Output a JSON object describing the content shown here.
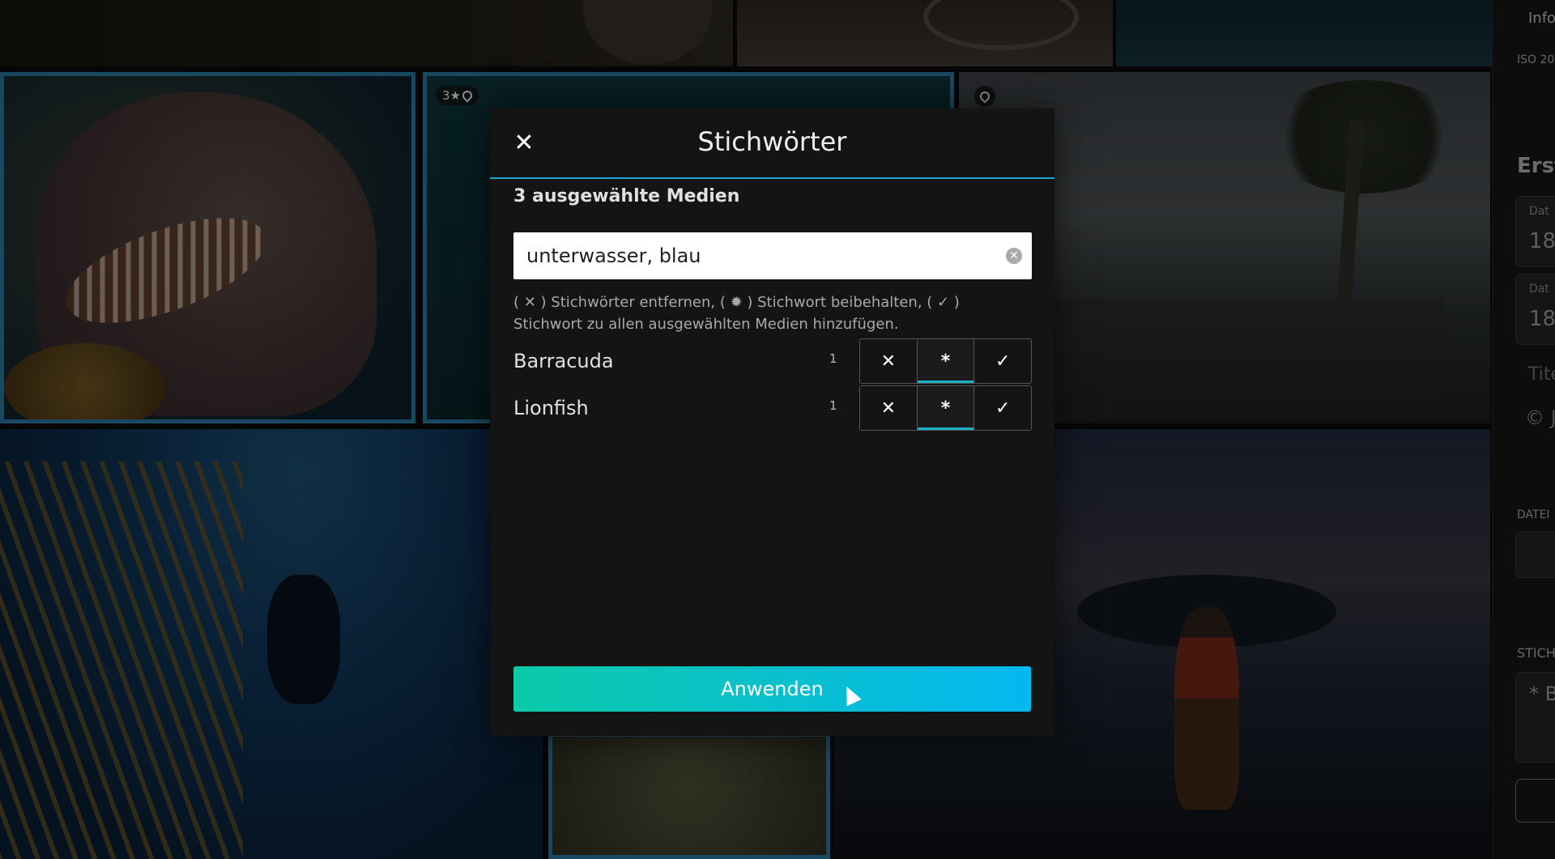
{
  "grid": {
    "badges": {
      "rating": "3★",
      "pin_icon": "map-pin-icon"
    }
  },
  "right_panel": {
    "info_tab": "Info",
    "iso_fragment": "ISO 20",
    "section_title": "Erste",
    "field1": {
      "label": "Dat",
      "value": "18"
    },
    "field2": {
      "label": "Dat",
      "value": "18"
    },
    "title_placeholder": "Tite",
    "copyright_fragment": "© J",
    "datei_label": "DATEI",
    "stich_label": "STICH",
    "keyword_fragment": "* Ba"
  },
  "modal": {
    "title": "Stichwörter",
    "close_icon": "close-icon",
    "selected_count_label": "3 ausgewählte Medien",
    "input_value": "unterwasser, blau",
    "clear_icon": "clear-circle-icon",
    "help_text": "( ✕ ) Stichwörter entfernen, ( ✹ ) Stichwort beibehalten, ( ✓ ) Stichwort zu allen ausgewählten Medien hinzufügen.",
    "options": {
      "remove": "✕",
      "keep": "*",
      "add": "✓"
    },
    "keywords": [
      {
        "name": "Barracuda",
        "count": "1",
        "selected": "keep"
      },
      {
        "name": "Lionfish",
        "count": "1",
        "selected": "keep"
      }
    ],
    "apply_label": "Anwenden"
  },
  "colors": {
    "accent": "#1aa6d8",
    "apply_gradient_start": "#0cc9a8",
    "apply_gradient_end": "#04b8f0",
    "selection_border": "#2a6f96"
  }
}
